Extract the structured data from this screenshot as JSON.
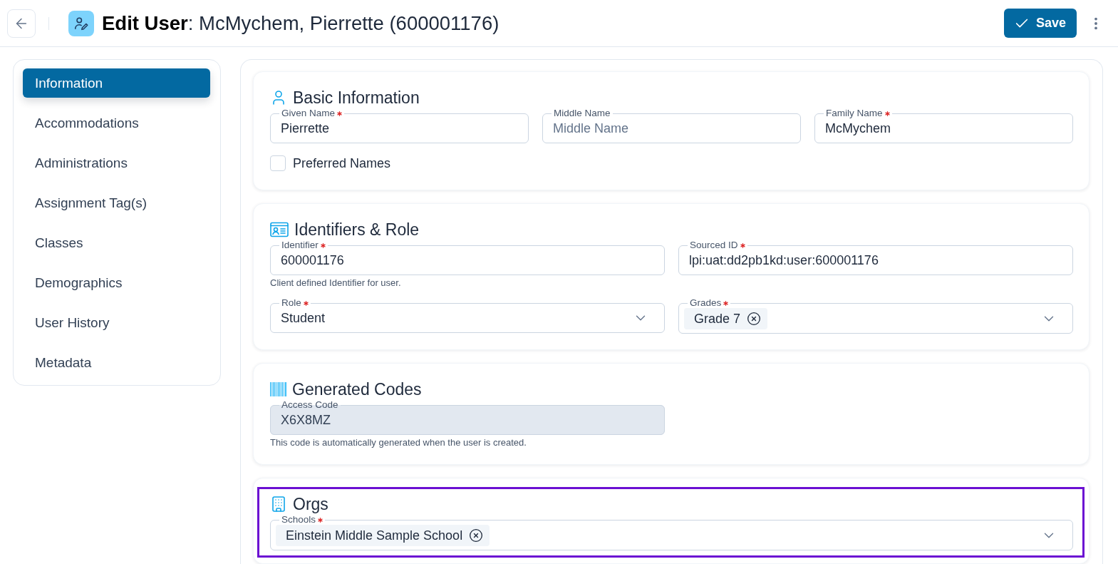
{
  "header": {
    "title": "**Edit User**: McMychem, Pierrette (600001176)",
    "save_label": "Save"
  },
  "sidebar": {
    "items": [
      {
        "label": "Information",
        "selected": true
      },
      {
        "label": "Accommodations",
        "selected": false
      },
      {
        "label": "Administrations",
        "selected": false
      },
      {
        "label": "Assignment Tag(s)",
        "selected": false
      },
      {
        "label": "Classes",
        "selected": false
      },
      {
        "label": "Demographics",
        "selected": false
      },
      {
        "label": "User History",
        "selected": false
      },
      {
        "label": "Metadata",
        "selected": false
      }
    ]
  },
  "sections": [
    {
      "kind": "basic",
      "title": "Basic Information",
      "highlighted": false,
      "rows": [
        {
          "fields": [
            {
              "kind": "text",
              "label": "Given Name",
              "required": true,
              "disabled": false,
              "value": "Pierrette"
            },
            {
              "kind": "text",
              "label": "Middle Name",
              "required": false,
              "disabled": false,
              "placeholder": "Middle Name"
            },
            {
              "kind": "text",
              "label": "Family Name",
              "required": true,
              "disabled": false,
              "value": "McMychem"
            }
          ]
        },
        {
          "fields": [
            {
              "kind": "checkbox",
              "label": "Preferred Names",
              "checked": false
            }
          ]
        }
      ]
    },
    {
      "kind": "identifiers",
      "title": "Identifiers & Role",
      "highlighted": false,
      "rows": [
        {
          "fields": [
            {
              "kind": "text",
              "label": "Identifier",
              "required": true,
              "disabled": false,
              "value": "600001176",
              "helper": "Client defined Identifier for user."
            },
            {
              "kind": "text",
              "label": "Sourced ID",
              "required": true,
              "disabled": false,
              "value": "lpi:uat:dd2pb1kd:user:600001176"
            }
          ]
        },
        {
          "fields": [
            {
              "kind": "select",
              "label": "Role",
              "required": true,
              "value": "Student"
            },
            {
              "kind": "multiselect",
              "label": "Grades",
              "required": true,
              "chips": [
                "Grade 7"
              ]
            }
          ]
        }
      ]
    },
    {
      "kind": "codes",
      "title": "Generated Codes",
      "highlighted": false,
      "rows": [
        {
          "fields": [
            {
              "kind": "text",
              "label": "Access Code",
              "required": false,
              "disabled": true,
              "value": "X6X8MZ",
              "helper": "This code is automatically generated when the user is created."
            }
          ]
        }
      ]
    },
    {
      "kind": "orgs",
      "title": "Orgs",
      "highlighted": true,
      "rows": [
        {
          "fields": [
            {
              "kind": "multiselect",
              "label": "Schools",
              "required": true,
              "chips": [
                "Einstein Middle Sample School"
              ]
            }
          ]
        }
      ]
    }
  ]
}
